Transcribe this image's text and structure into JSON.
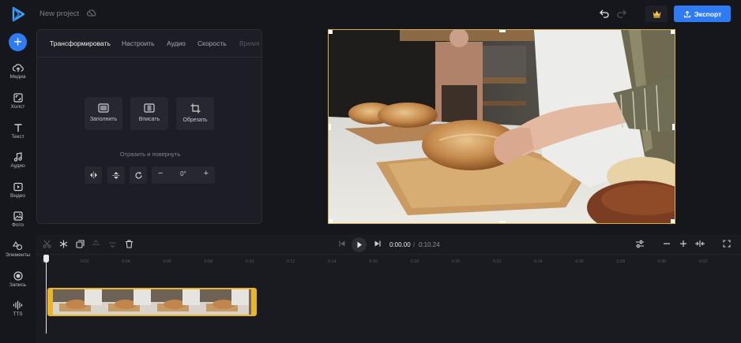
{
  "app": {
    "project_title": "New project",
    "export_label": "Экспорт"
  },
  "sidebar": {
    "add_label": "+",
    "items": [
      {
        "label": "Медиа",
        "icon": "cloud-upload-icon"
      },
      {
        "label": "Холст",
        "icon": "canvas-resize-icon"
      },
      {
        "label": "Текст",
        "icon": "text-icon"
      },
      {
        "label": "Аудио",
        "icon": "music-note-icon"
      },
      {
        "label": "Видео",
        "icon": "video-play-icon"
      },
      {
        "label": "Фото",
        "icon": "image-icon"
      },
      {
        "label": "Элементы",
        "icon": "shapes-icon"
      },
      {
        "label": "Запись",
        "icon": "record-icon"
      },
      {
        "label": "TTS",
        "icon": "sound-wave-icon"
      }
    ]
  },
  "panel": {
    "tabs": [
      {
        "label": "Трансформировать",
        "active": true
      },
      {
        "label": "Настроить",
        "active": false
      },
      {
        "label": "Аудио",
        "active": false
      },
      {
        "label": "Скорость",
        "active": false
      },
      {
        "label": "Время",
        "active": false
      }
    ],
    "tools": [
      {
        "label": "Заполнить",
        "icon": "fill-icon"
      },
      {
        "label": "Вписать",
        "icon": "fit-icon"
      },
      {
        "label": "Обрезать",
        "icon": "crop-icon"
      }
    ],
    "rotate_section_label": "Отразить и повернуть",
    "rotation_value": "0°",
    "minus": "−",
    "plus": "+"
  },
  "timeline": {
    "current_time": "0:00.00",
    "separator": "/",
    "total_time": "0:10.24",
    "ruler_ticks": [
      "0",
      "0:02",
      "0:04",
      "0:06",
      "0:08",
      "0:10",
      "0:12",
      "0:14",
      "0:16",
      "0:18",
      "0:20",
      "0:22",
      "0:24",
      "0:26",
      "0:28",
      "0:30",
      "0:32"
    ]
  },
  "colors": {
    "accent": "#2f7bf5",
    "selection": "#d6b047",
    "clip_border": "#e8b52d",
    "background": "#16171d"
  }
}
